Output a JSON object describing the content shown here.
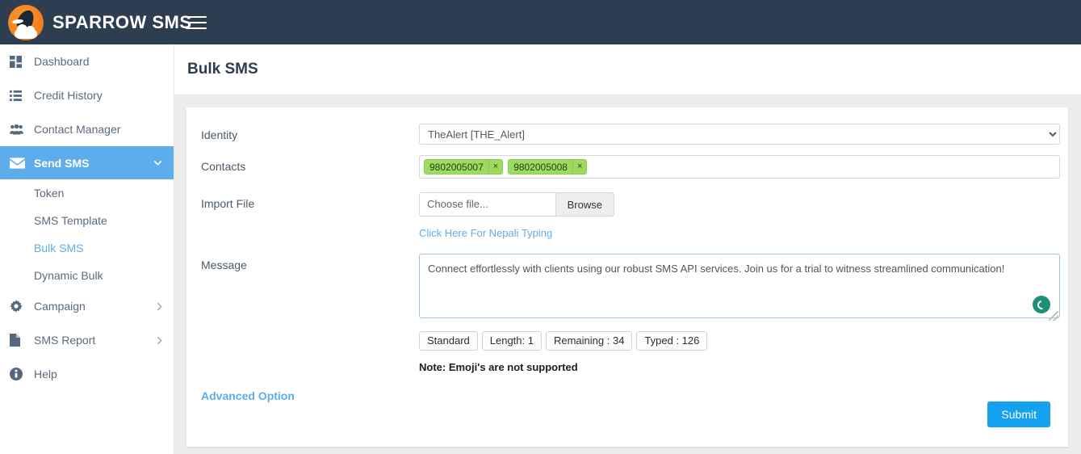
{
  "topbar": {
    "brand": "SPARROW SMS",
    "logo_icon": "sparrow-bird-logo",
    "menu_icon": "hamburger-menu-icon"
  },
  "sidebar": {
    "items": [
      {
        "label": "Dashboard",
        "icon": "dashboard-grid-icon",
        "active": false,
        "caret": ""
      },
      {
        "label": "Credit History",
        "icon": "list-icon",
        "active": false,
        "caret": ""
      },
      {
        "label": "Contact Manager",
        "icon": "users-group-icon",
        "active": false,
        "caret": ""
      },
      {
        "label": "Send SMS",
        "icon": "envelope-icon",
        "active": true,
        "caret": "chevron-down-icon"
      },
      {
        "label": "Campaign",
        "icon": "gear-icon",
        "active": false,
        "caret": "chevron-right-icon"
      },
      {
        "label": "SMS Report",
        "icon": "document-icon",
        "active": false,
        "caret": "chevron-right-icon"
      },
      {
        "label": "Help",
        "icon": "info-circle-icon",
        "active": false,
        "caret": ""
      }
    ],
    "sub_items": [
      {
        "label": "Token",
        "selected": false
      },
      {
        "label": "SMS Template",
        "selected": false
      },
      {
        "label": "Bulk SMS",
        "selected": true
      },
      {
        "label": "Dynamic Bulk",
        "selected": false
      }
    ]
  },
  "page": {
    "title": "Bulk SMS"
  },
  "form": {
    "identity": {
      "label": "Identity",
      "selected": "TheAlert [THE_Alert]",
      "options": [
        "TheAlert [THE_Alert]"
      ]
    },
    "contacts": {
      "label": "Contacts",
      "tags": [
        "9802005007",
        "9802005008"
      ],
      "remove_glyph": "×"
    },
    "import_file": {
      "label": "Import File",
      "placeholder": "Choose file...",
      "browse_label": "Browse",
      "nepali_link": "Click Here For Nepali Typing"
    },
    "message": {
      "label": "Message",
      "value": "Connect effortlessly with clients using our robust SMS API services. Join us for a trial to witness streamlined communication!",
      "spinner_icon": "loading-spinner-icon"
    },
    "stats": [
      "Standard",
      "Length: 1",
      "Remaining : 34",
      "Typed : 126"
    ],
    "note": "Note: Emoji's are not supported",
    "advanced_option": "Advanced Option",
    "submit_label": "Submit"
  },
  "colors": {
    "topbar": "#2C3E50",
    "active_nav": "#5EADEB",
    "link": "#5EADEB",
    "tag": "#9CDB5F",
    "submit": "#14A2F0",
    "spinner": "#1E8F73",
    "page_bg": "#ECECEC"
  }
}
